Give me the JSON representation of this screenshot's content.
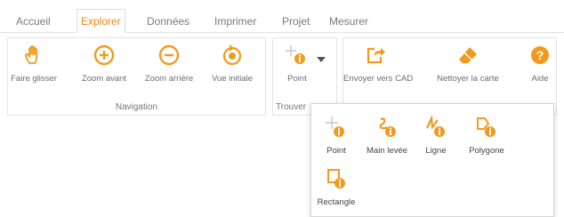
{
  "colors": {
    "accent": "#F39A1E",
    "active_tab": "#E8871E",
    "icon_gray": "#9a9a9a"
  },
  "tabs": [
    {
      "label": "Accueil"
    },
    {
      "label": "Explorer"
    },
    {
      "label": "Données"
    },
    {
      "label": "Imprimer"
    },
    {
      "label": "Projet"
    },
    {
      "label": "Mesurer"
    }
  ],
  "active_tab": "Explorer",
  "navigation": {
    "label": "Navigation",
    "buttons": [
      {
        "label": "Faire glisser",
        "icon": "hand-icon"
      },
      {
        "label": "Zoom avant",
        "icon": "zoom-in-icon"
      },
      {
        "label": "Zoom arrière",
        "icon": "zoom-out-icon"
      },
      {
        "label": "Vue initiale",
        "icon": "initial-view-icon"
      }
    ]
  },
  "trouver": {
    "label": "Trouver",
    "button": {
      "label": "Point",
      "icon": "point-info-icon"
    }
  },
  "actions": {
    "buttons": [
      {
        "label": "Envoyer vers CAD",
        "icon": "send-to-cad-icon"
      },
      {
        "label": "Nettoyer la carte",
        "icon": "eraser-icon"
      },
      {
        "label": "Aide",
        "icon": "help-icon"
      }
    ]
  },
  "dropdown": {
    "items": [
      {
        "label": "Point",
        "icon": "point-info-icon"
      },
      {
        "label": "Main levée",
        "icon": "freehand-info-icon"
      },
      {
        "label": "Ligne",
        "icon": "line-info-icon"
      },
      {
        "label": "Polygone",
        "icon": "polygon-info-icon"
      },
      {
        "label": "Rectangle",
        "icon": "rectangle-info-icon"
      }
    ]
  }
}
